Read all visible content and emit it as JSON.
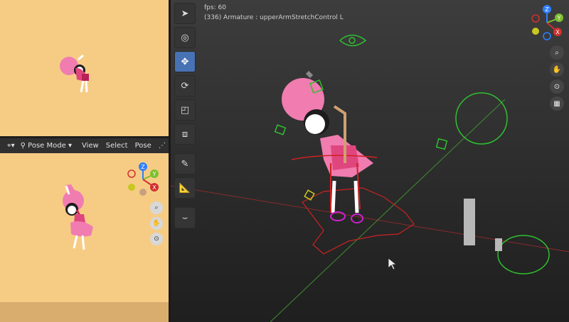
{
  "header": {
    "mode_label": "Pose Mode",
    "menus": [
      "View",
      "Select",
      "Pose"
    ]
  },
  "viewport": {
    "fps_label": "fps: 60",
    "object_label": "(336) Armature : upperArmStretchControl L"
  },
  "gizmo": {
    "axis_labels": [
      "Z",
      "Y",
      "X"
    ]
  },
  "toolbar": {
    "tools": [
      "select-box-icon",
      "cursor-icon",
      "move-icon",
      "rotate-icon",
      "scale-icon",
      "transform-icon",
      "annotate-icon",
      "measure-icon",
      "curve-icon"
    ]
  },
  "colors": {
    "camera_bg": "#f6cc85",
    "active_tool": "#4772b3",
    "bone_green": "#2fbf2f",
    "ik_red": "#cc2222",
    "pink": "#f07cb0"
  }
}
